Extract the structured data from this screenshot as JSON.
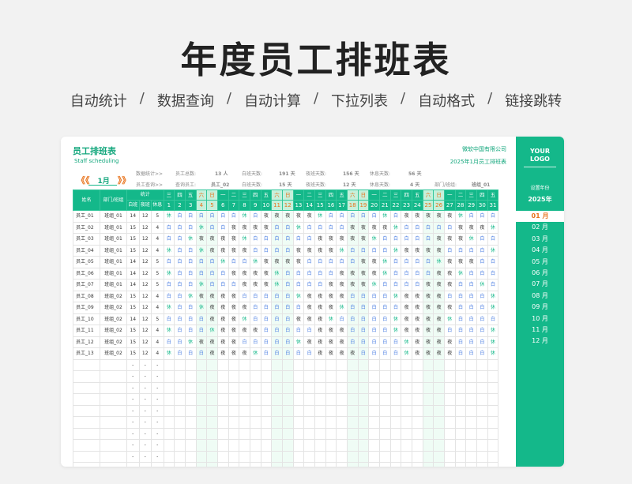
{
  "page_title": "年度员工排班表",
  "features": [
    "自动统计",
    "数据查询",
    "自动计算",
    "下拉列表",
    "自动格式",
    "链接跳转"
  ],
  "features_sep": "/",
  "sheet": {
    "title": "员工排班表",
    "subtitle": "Staff scheduling",
    "company": "微软中国有限公司",
    "caption": "2025年1月员工排班表"
  },
  "month_nav": {
    "prev": "《《",
    "value": "1月",
    "next": "》》"
  },
  "stats": {
    "row1": {
      "label": "数据统计>>",
      "total_label": "员工总数:",
      "total_value": "13 人",
      "day_label": "白班天数:",
      "day_value": "191 天",
      "night_label": "夜班天数:",
      "night_value": "156 天",
      "rest_label": "休息天数:",
      "rest_value": "56 天"
    },
    "row2": {
      "label": "员工查询>>",
      "emp_label": "查询员工:",
      "emp_value": "员工_02",
      "day_label": "白班天数:",
      "day_value": "15 天",
      "night_label": "夜班天数:",
      "night_value": "12 天",
      "rest_label": "休息天数:",
      "rest_value": "4 天",
      "dept_label": "部门/班组:",
      "dept_value": "班组_01"
    }
  },
  "table": {
    "col_name": "姓名",
    "col_dept": "部门/班组",
    "col_stats": "统计",
    "sub_headers": [
      "白班",
      "夜班",
      "休息"
    ],
    "weekdays": [
      "三",
      "四",
      "五",
      "六",
      "日",
      "一",
      "二",
      "三",
      "四",
      "五",
      "六",
      "日",
      "一",
      "二",
      "三",
      "四",
      "五",
      "六",
      "日",
      "一",
      "二",
      "三",
      "四",
      "五",
      "六",
      "日",
      "一",
      "二",
      "三",
      "四",
      "五"
    ],
    "days": [
      "1",
      "2",
      "3",
      "4",
      "5",
      "6",
      "7",
      "8",
      "9",
      "10",
      "11",
      "12",
      "13",
      "14",
      "15",
      "16",
      "17",
      "18",
      "19",
      "20",
      "21",
      "22",
      "23",
      "24",
      "25",
      "26",
      "27",
      "28",
      "29",
      "30",
      "31"
    ],
    "shift_legend": {
      "白": "day",
      "夜": "night",
      "休": "rest"
    },
    "empty_placeholder": "-",
    "empty_row_count": 10,
    "rows": [
      {
        "name": "员工_01",
        "dept": "班组_01",
        "day": "14",
        "night": "12",
        "rest": "5",
        "shifts": "休白白白白白白休白夜夜夜夜夜休白白白白白休白夜夜夜夜夜休白白白"
      },
      {
        "name": "员工_02",
        "dept": "班组_01",
        "day": "15",
        "night": "12",
        "rest": "4",
        "shifts": "白白白休白白夜夜夜夜白白休白白白白夜夜夜夜休白白白白白夜夜夜休"
      },
      {
        "name": "员工_03",
        "dept": "班组_01",
        "day": "15",
        "night": "12",
        "rest": "4",
        "shifts": "白白休夜夜夜夜休白白白白白白夜夜夜夜夜休白白白白白夜夜夜休白白"
      },
      {
        "name": "员工_04",
        "dept": "班组_01",
        "day": "15",
        "night": "12",
        "rest": "4",
        "shifts": "休白白休夜夜夜夜白白白白夜夜夜夜休白白白白休夜夜夜夜白白白白休"
      },
      {
        "name": "员工_05",
        "dept": "班组_01",
        "day": "14",
        "night": "12",
        "rest": "5",
        "shifts": "白白白白白休白白休夜夜夜夜白白白白白夜夜休白白白白休夜夜夜白白"
      },
      {
        "name": "员工_06",
        "dept": "班组_01",
        "day": "14",
        "night": "12",
        "rest": "5",
        "shifts": "休白白白白白夜夜夜夜休白白白白白夜夜夜夜休白白白白夜夜休白白白"
      },
      {
        "name": "员工_07",
        "dept": "班组_01",
        "day": "14",
        "night": "12",
        "rest": "5",
        "shifts": "白白白休白白白夜夜夜休白白白白夜夜夜夜休白白白白夜夜夜白白休白"
      },
      {
        "name": "员工_08",
        "dept": "班组_02",
        "day": "15",
        "night": "12",
        "rest": "4",
        "shifts": "白白休夜夜夜夜白白白白白休夜夜夜夜白白白白休夜夜夜夜白白白白休"
      },
      {
        "name": "员工_09",
        "dept": "班组_02",
        "day": "15",
        "night": "12",
        "rest": "4",
        "shifts": "休白白休夜夜夜夜白白白白白夜夜夜休白白白白白夜夜夜夜夜白白白休"
      },
      {
        "name": "员工_10",
        "dept": "班组_02",
        "day": "14",
        "night": "12",
        "rest": "5",
        "shifts": "白白白白夜夜夜休白白白白夜夜夜休白白白白白休夜夜夜夜休白白白白"
      },
      {
        "name": "员工_11",
        "dept": "班组_02",
        "day": "15",
        "night": "12",
        "rest": "4",
        "shifts": "休白白白休夜夜夜夜白白白白白夜夜夜白白白白休夜夜夜夜白白白白休"
      },
      {
        "name": "员工_12",
        "dept": "班组_02",
        "day": "15",
        "night": "12",
        "rest": "4",
        "shifts": "白白休夜夜夜夜白白白白白休夜夜夜夜白白白白白休夜夜夜夜白白白休"
      },
      {
        "name": "员工_13",
        "dept": "班组_02",
        "day": "15",
        "night": "12",
        "rest": "4",
        "shifts": "休白白白夜夜夜夜休白白白白白夜夜夜夜白白白白休夜夜夜夜白白白休"
      }
    ]
  },
  "sidebar": {
    "logo_line1": "YOUR",
    "logo_line2": "LOGO",
    "select_label": "设置年份",
    "year": "2025年",
    "months": [
      "01 月",
      "02 月",
      "03 月",
      "04 月",
      "05 月",
      "06 月",
      "07 月",
      "08 月",
      "09 月",
      "10 月",
      "11 月",
      "12 月"
    ],
    "active_month_index": 0
  },
  "colors": {
    "accent": "#14b88a",
    "weekend": "#e8731c",
    "day_shift": "#4a7de2",
    "rest": "#14b88a"
  }
}
